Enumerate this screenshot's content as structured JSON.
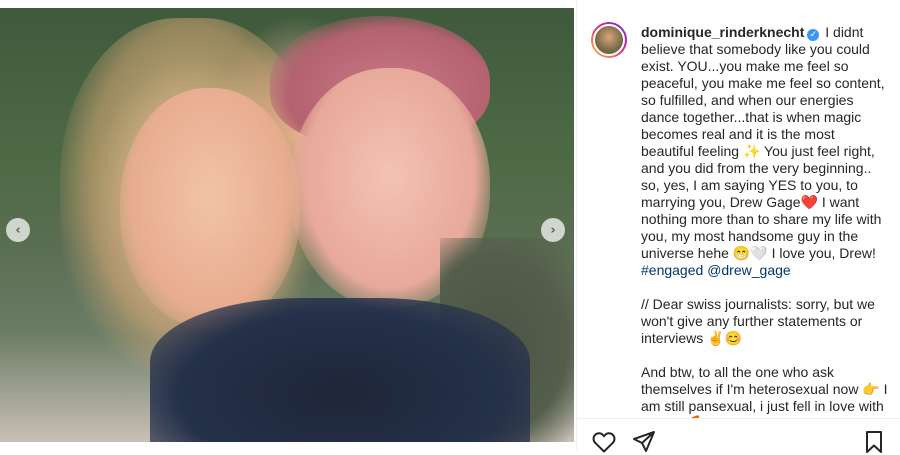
{
  "post": {
    "image_alt": "",
    "carousel": {
      "prev_glyph": "‹",
      "next_glyph": "›"
    }
  },
  "caption": {
    "username": "dominique_rinderknecht",
    "verified_glyph": "✓",
    "text_part1": "I didnt believe that somebody like you could exist. YOU...you make me feel so peaceful, you make me feel so content, so fulfilled, and when our energies dance together...that is when magic becomes real and it is the most beautiful feeling ✨ You just feel right, and you did from the very beginning.. so, yes, I am saying YES to you, to marrying you, Drew Gage❤️ I want nothing more than to share my life with you, my most handsome guy in the universe hehe 😁🤍 I love you, Drew! ",
    "hashtag": "#engaged",
    "mention": "@drew_gage",
    "paragraph2": "// Dear swiss journalists: sorry, but we won't give any further statements or interviews ✌️😊",
    "paragraph3": "And btw, to all the one who ask themselves if I'm heterosexual now 👉 I am still pansexual, i just fell in love with a man 🌈"
  },
  "actions": {
    "like_icon": "heart-outline",
    "share_icon": "paper-plane",
    "save_icon": "bookmark"
  },
  "colors": {
    "verified": "#3897f0",
    "link": "#00376b",
    "text": "#262626"
  }
}
